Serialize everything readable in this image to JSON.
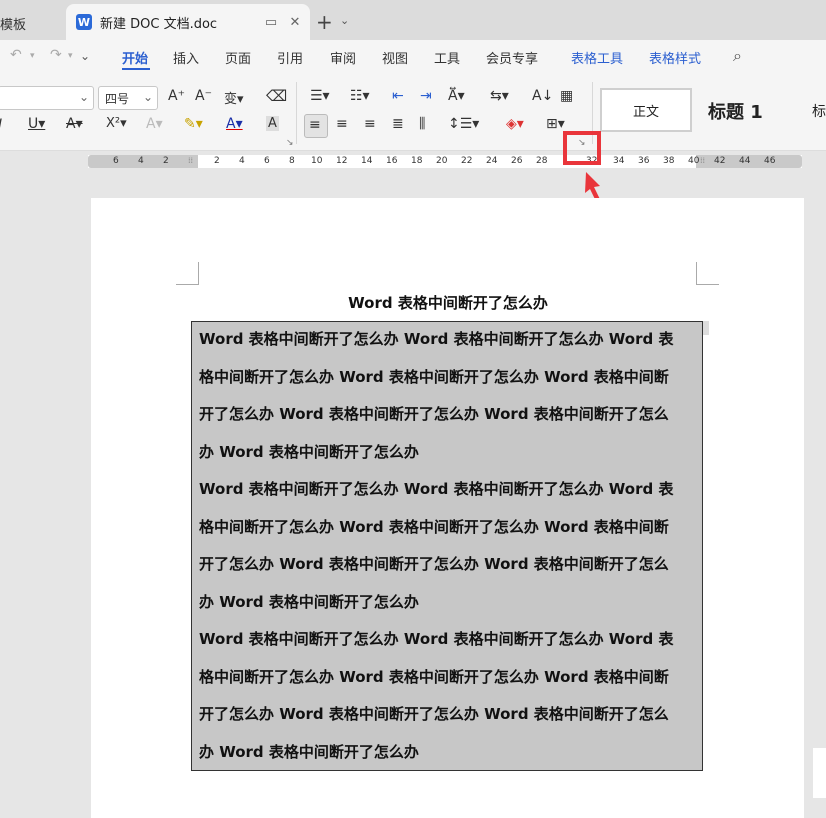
{
  "tabs": {
    "prev_label": "模板",
    "active_label": "新建 DOC 文档.doc",
    "new_tab": "+"
  },
  "menu": {
    "items": [
      "开始",
      "插入",
      "页面",
      "引用",
      "审阅",
      "视图",
      "工具",
      "会员专享",
      "表格工具",
      "表格样式"
    ],
    "active": "开始"
  },
  "ribbon": {
    "font_size": "四号",
    "styles": {
      "normal": "正文",
      "heading1": "标题 1",
      "heading2": "标"
    }
  },
  "ruler": {
    "left_ticks": [
      "6",
      "4",
      "2"
    ],
    "main_ticks": [
      "2",
      "4",
      "6",
      "8",
      "10",
      "12",
      "14",
      "16",
      "18",
      "20",
      "22",
      "24",
      "26",
      "28",
      "32",
      "34",
      "36",
      "38",
      "40"
    ],
    "right_ticks": [
      "42",
      "44",
      "46"
    ]
  },
  "document": {
    "title": "Word 表格中间断开了怎么办",
    "paragraphs": [
      [
        "Word 表格中间断开了怎么办 Word 表格中间断开了怎么办 Word 表",
        "格中间断开了怎么办 Word 表格中间断开了怎么办 Word 表格中间断",
        "开了怎么办 Word 表格中间断开了怎么办 Word 表格中间断开了怎么",
        "办 Word 表格中间断开了怎么办"
      ],
      [
        "Word 表格中间断开了怎么办 Word 表格中间断开了怎么办 Word 表",
        "格中间断开了怎么办 Word 表格中间断开了怎么办 Word 表格中间断",
        "开了怎么办 Word 表格中间断开了怎么办 Word 表格中间断开了怎么",
        "办 Word 表格中间断开了怎么办"
      ],
      [
        "Word 表格中间断开了怎么办 Word 表格中间断开了怎么办 Word 表",
        "格中间断开了怎么办 Word 表格中间断开了怎么办 Word 表格中间断",
        "开了怎么办 Word 表格中间断开了怎么办 Word 表格中间断开了怎么",
        "办 Word 表格中间断开了怎么办"
      ]
    ]
  },
  "colors": {
    "accent": "#2b5fd0",
    "highlight": "#e9353b",
    "table_bg": "#c7c7c7"
  }
}
